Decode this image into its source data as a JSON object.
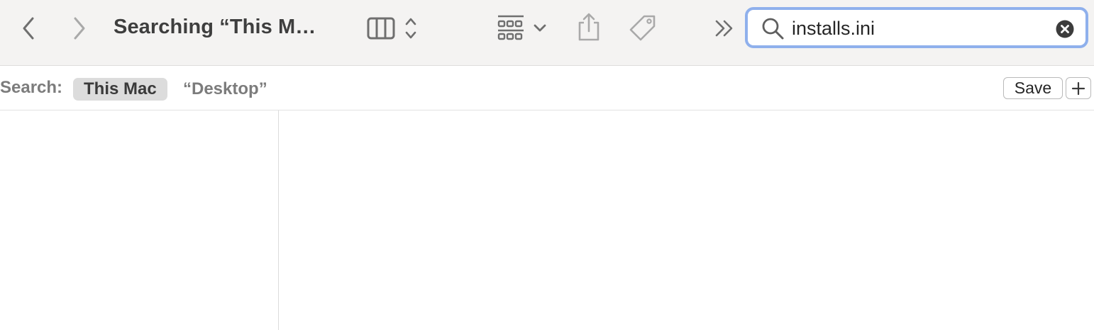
{
  "toolbar": {
    "title": "Searching “This M…",
    "icons": {
      "back": "chevron-left-icon",
      "forward": "chevron-right-icon",
      "view_columns": "columns-view-icon",
      "view_switch": "up-down-chevron-icon",
      "group": "grid-group-icon",
      "group_menu": "chevron-down-icon",
      "share": "share-icon",
      "tag": "tag-icon",
      "overflow": "double-chevron-right-icon"
    }
  },
  "search": {
    "value": "installs.ini",
    "icon": "magnifying-glass-icon",
    "clear_icon": "clear-x-icon"
  },
  "scope_bar": {
    "label": "Search:",
    "scopes": [
      "This Mac",
      "“Desktop”"
    ],
    "selected": "This Mac",
    "save_label": "Save",
    "add_icon": "plus-icon"
  },
  "colors": {
    "toolbar_bg": "#f4f3f2",
    "focus_ring": "#8fb0ec",
    "selected_scope_bg": "#dcdcdc",
    "icon_gray": "#6f6f6f",
    "icon_disabled": "#a9a9a9"
  }
}
